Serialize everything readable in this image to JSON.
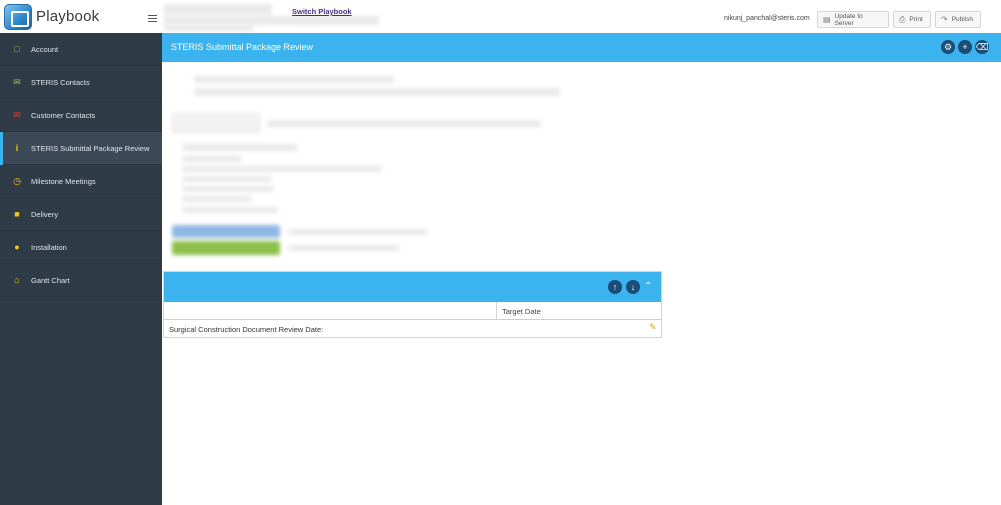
{
  "app": {
    "name": "Playbook",
    "switch_link": "Switch Playbook"
  },
  "header": {
    "user_email": "nikunj_panchal@steris.com",
    "update_label": "Update to Server",
    "print_label": "Print",
    "publish_label": "Publish"
  },
  "sidebar": {
    "items": [
      {
        "label": "Account",
        "icon": "monitor-icon",
        "color": "#8bc34a"
      },
      {
        "label": "STERIS Contacts",
        "icon": "envelope-icon",
        "color": "#8bc34a"
      },
      {
        "label": "Customer Contacts",
        "icon": "envelope-icon",
        "color": "#e53935"
      },
      {
        "label": "STERIS Submittal Package Review",
        "icon": "info-icon",
        "color": "#f5c518"
      },
      {
        "label": "Milestone Meetings",
        "icon": "clock-icon",
        "color": "#f5c518"
      },
      {
        "label": "Delivery",
        "icon": "lock-icon",
        "color": "#f5c518"
      },
      {
        "label": "Installation",
        "icon": "lightbulb-icon",
        "color": "#f5c518"
      },
      {
        "label": "Gantt Chart",
        "icon": "home-icon",
        "color": "#f5c518"
      }
    ]
  },
  "main": {
    "title": "STERIS Submittal Package Review"
  },
  "panel": {
    "column_header": "Target Date",
    "row_label": "Surgical Construction Document Review Date:"
  },
  "colors": {
    "accent": "#3bb3ee",
    "sidebar": "#2f3b47",
    "button_dark": "#1a4d78"
  }
}
